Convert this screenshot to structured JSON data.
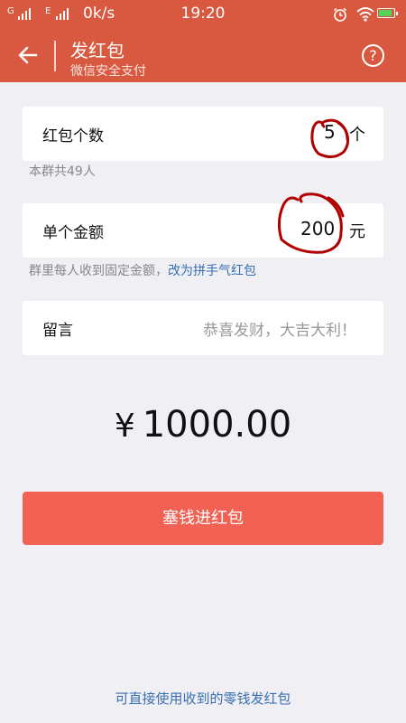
{
  "status_bar": {
    "sim1": "G",
    "sim2": "E",
    "speed": "0k/s",
    "time": "19:20"
  },
  "header": {
    "title": "发红包",
    "subtitle": "微信安全支付",
    "help": "?"
  },
  "count_card": {
    "label": "红包个数",
    "value": "5",
    "unit": "个",
    "hint": "本群共49人"
  },
  "amount_card": {
    "label": "单个金额",
    "value": "200",
    "unit": "元",
    "hint": "群里每人收到固定金额，",
    "hint_link": "改为拼手气红包"
  },
  "message_card": {
    "label": "留言",
    "placeholder": "恭喜发财，大吉大利！"
  },
  "total": {
    "currency": "¥",
    "value": "1000.00"
  },
  "submit_button": "塞钱进红包",
  "bottom_link": "可直接使用收到的零钱发红包",
  "colors": {
    "header": "#d85940",
    "button": "#f26254",
    "link": "#3a6fb0",
    "annotation": "#b00000"
  },
  "icons": [
    "back-arrow-icon",
    "help-icon",
    "signal-icon",
    "alarm-icon",
    "wifi-icon",
    "battery-icon"
  ]
}
